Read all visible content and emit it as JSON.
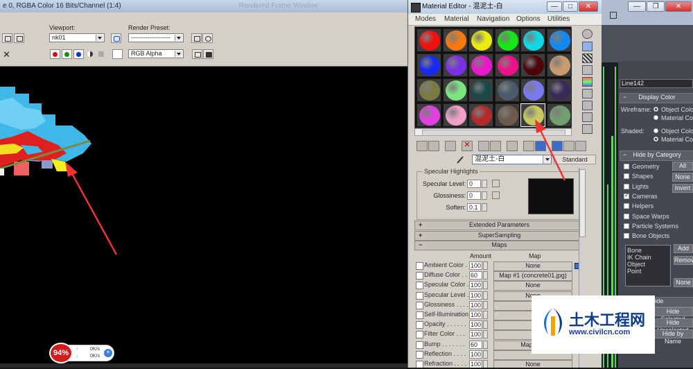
{
  "render_window": {
    "title": "e 0, RGBA Color 16 Bits/Channel (1:4)",
    "ghost_title": "Rendered Frame Window",
    "viewport_label": "Viewport:",
    "viewport_value": "nk01",
    "render_preset_label": "Render Preset:",
    "render_preset_value": "-------------------",
    "channel_value": "RGB Alpha",
    "close_glyph": "✕"
  },
  "material_editor": {
    "title": "Material Editor - 混泥土-白",
    "menu": [
      "Modes",
      "Material",
      "Navigation",
      "Options",
      "Utilities"
    ],
    "slots": [
      "#f01010",
      "#f47a10",
      "#eaea10",
      "#16e616",
      "#10d8e0",
      "#1488f0",
      "#1a2af0",
      "#7a30e6",
      "#ea16c8",
      "#f0108a",
      "#4a0608",
      "#c89a70",
      "#7a7a40",
      "#7ae680",
      "#1a4a48",
      "#4a5a6a",
      "#7a7af0",
      "#3a2a5a",
      "#e040e0",
      "#f0a0c8",
      "#b42a2a",
      "#6e5a4a",
      "#c8c860",
      "#70a070"
    ],
    "material_name": "混泥土-白",
    "material_type": "Standard",
    "specular": {
      "group_label": "Specular Highlights",
      "level_label": "Specular Level:",
      "level_value": "0",
      "gloss_label": "Glossiness:",
      "gloss_value": "0",
      "soften_label": "Soften:",
      "soften_value": "0.1"
    },
    "rollouts": {
      "extended": "Extended Parameters",
      "supersampling": "SuperSampling",
      "maps": "Maps"
    },
    "maps_header": {
      "amount": "Amount",
      "map": "Map"
    },
    "maps": [
      {
        "name": "Ambient Color . .",
        "amount": "100",
        "map": "None"
      },
      {
        "name": "Diffuse Color . .",
        "amount": "60",
        "map": "Map #1 (concrete01.jpg)"
      },
      {
        "name": "Specular Color . .",
        "amount": "100",
        "map": "None"
      },
      {
        "name": "Specular Level . .",
        "amount": "100",
        "map": "None"
      },
      {
        "name": "Glossiness . . . .",
        "amount": "100",
        "map": ""
      },
      {
        "name": "Self-Illumination .",
        "amount": "100",
        "map": ""
      },
      {
        "name": "Opacity . . . . . .",
        "amount": "100",
        "map": ""
      },
      {
        "name": "Filter Color . . .",
        "amount": "100",
        "map": ""
      },
      {
        "name": "Bump . . . . . . .",
        "amount": "60",
        "map": "Map #1 ("
      },
      {
        "name": "Reflection . . . .",
        "amount": "100",
        "map": ""
      },
      {
        "name": "Refraction . . . .",
        "amount": "100",
        "map": "None"
      }
    ]
  },
  "command_panel": {
    "object_name": "Line142",
    "display_color": {
      "title": "Display Color",
      "wireframe_label": "Wireframe:",
      "shaded_label": "Shaded:",
      "object_color": "Object Color",
      "material_color": "Material Color"
    },
    "hide_by_category": {
      "title": "Hide by Category",
      "items": [
        "Geometry",
        "Shapes",
        "Lights",
        "Cameras",
        "Helpers",
        "Space Warps",
        "Particle Systems",
        "Bone Objects"
      ],
      "all_btn": "All",
      "none_btn": "None",
      "invert_btn": "Invert",
      "list": [
        "Bone",
        "IK Chain Object",
        "Point"
      ],
      "add_btn": "Add",
      "remove_btn": "Remove",
      "none2_btn": "None"
    },
    "hide_title": "Hide",
    "hide_selected": "Hide Selected",
    "hide_unselected": "Hide Unselected",
    "hide_by_name": "Hide by Name"
  },
  "perf_widget": {
    "percent": "94%",
    "up": "0K/s",
    "down": "0K/s"
  },
  "watermark": {
    "title": "土木工程网",
    "url": "www.civilcn.com"
  }
}
